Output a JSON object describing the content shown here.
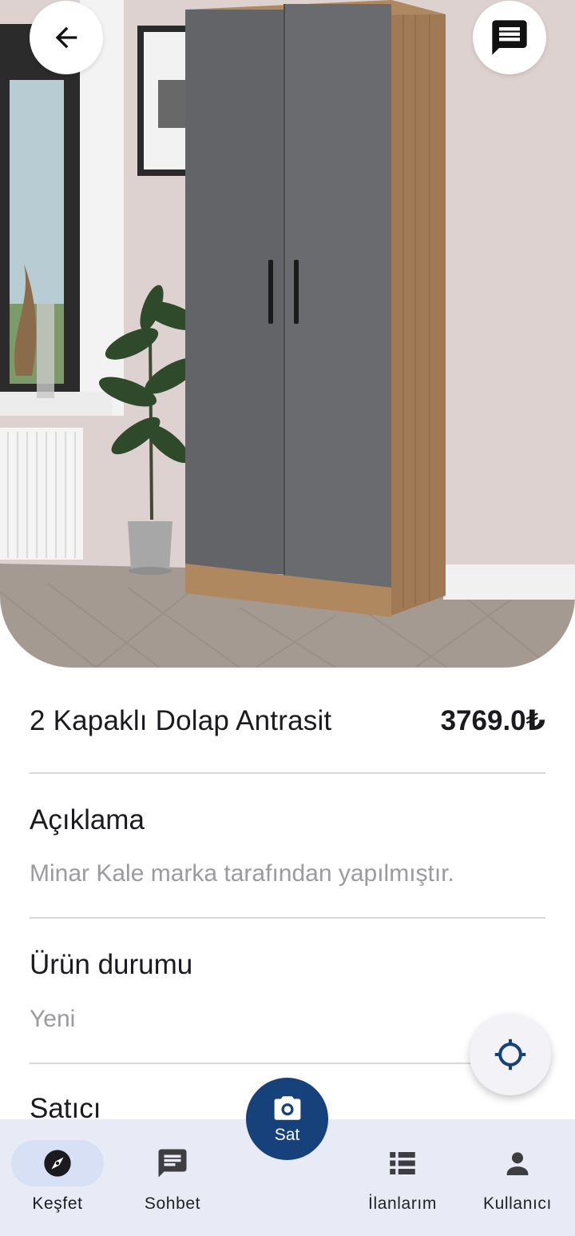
{
  "product": {
    "title": "2 Kapaklı Dolap Antrasit",
    "price": "3769.0₺"
  },
  "sections": [
    {
      "title": "Açıklama",
      "value": "Minar Kale marka tarafından yapılmıştır."
    },
    {
      "title": "Ürün durumu",
      "value": "Yeni"
    },
    {
      "title": "Satıcı"
    }
  ],
  "sell_fab": {
    "label": "Sat",
    "icon": "camera-icon"
  },
  "nav": {
    "items": [
      {
        "label": "Keşfet",
        "icon": "compass-icon",
        "active": true
      },
      {
        "label": "Sohbet",
        "icon": "chat-icon",
        "active": false
      },
      {
        "label": "İlanlarım",
        "icon": "list-icon",
        "active": false
      },
      {
        "label": "Kullanıcı",
        "icon": "person-icon",
        "active": false
      }
    ]
  },
  "colors": {
    "accent": "#16417a",
    "nav_background": "#e8ebf6",
    "active_pill": "#d7e0f4",
    "secondary_text": "#9a9a9f"
  }
}
